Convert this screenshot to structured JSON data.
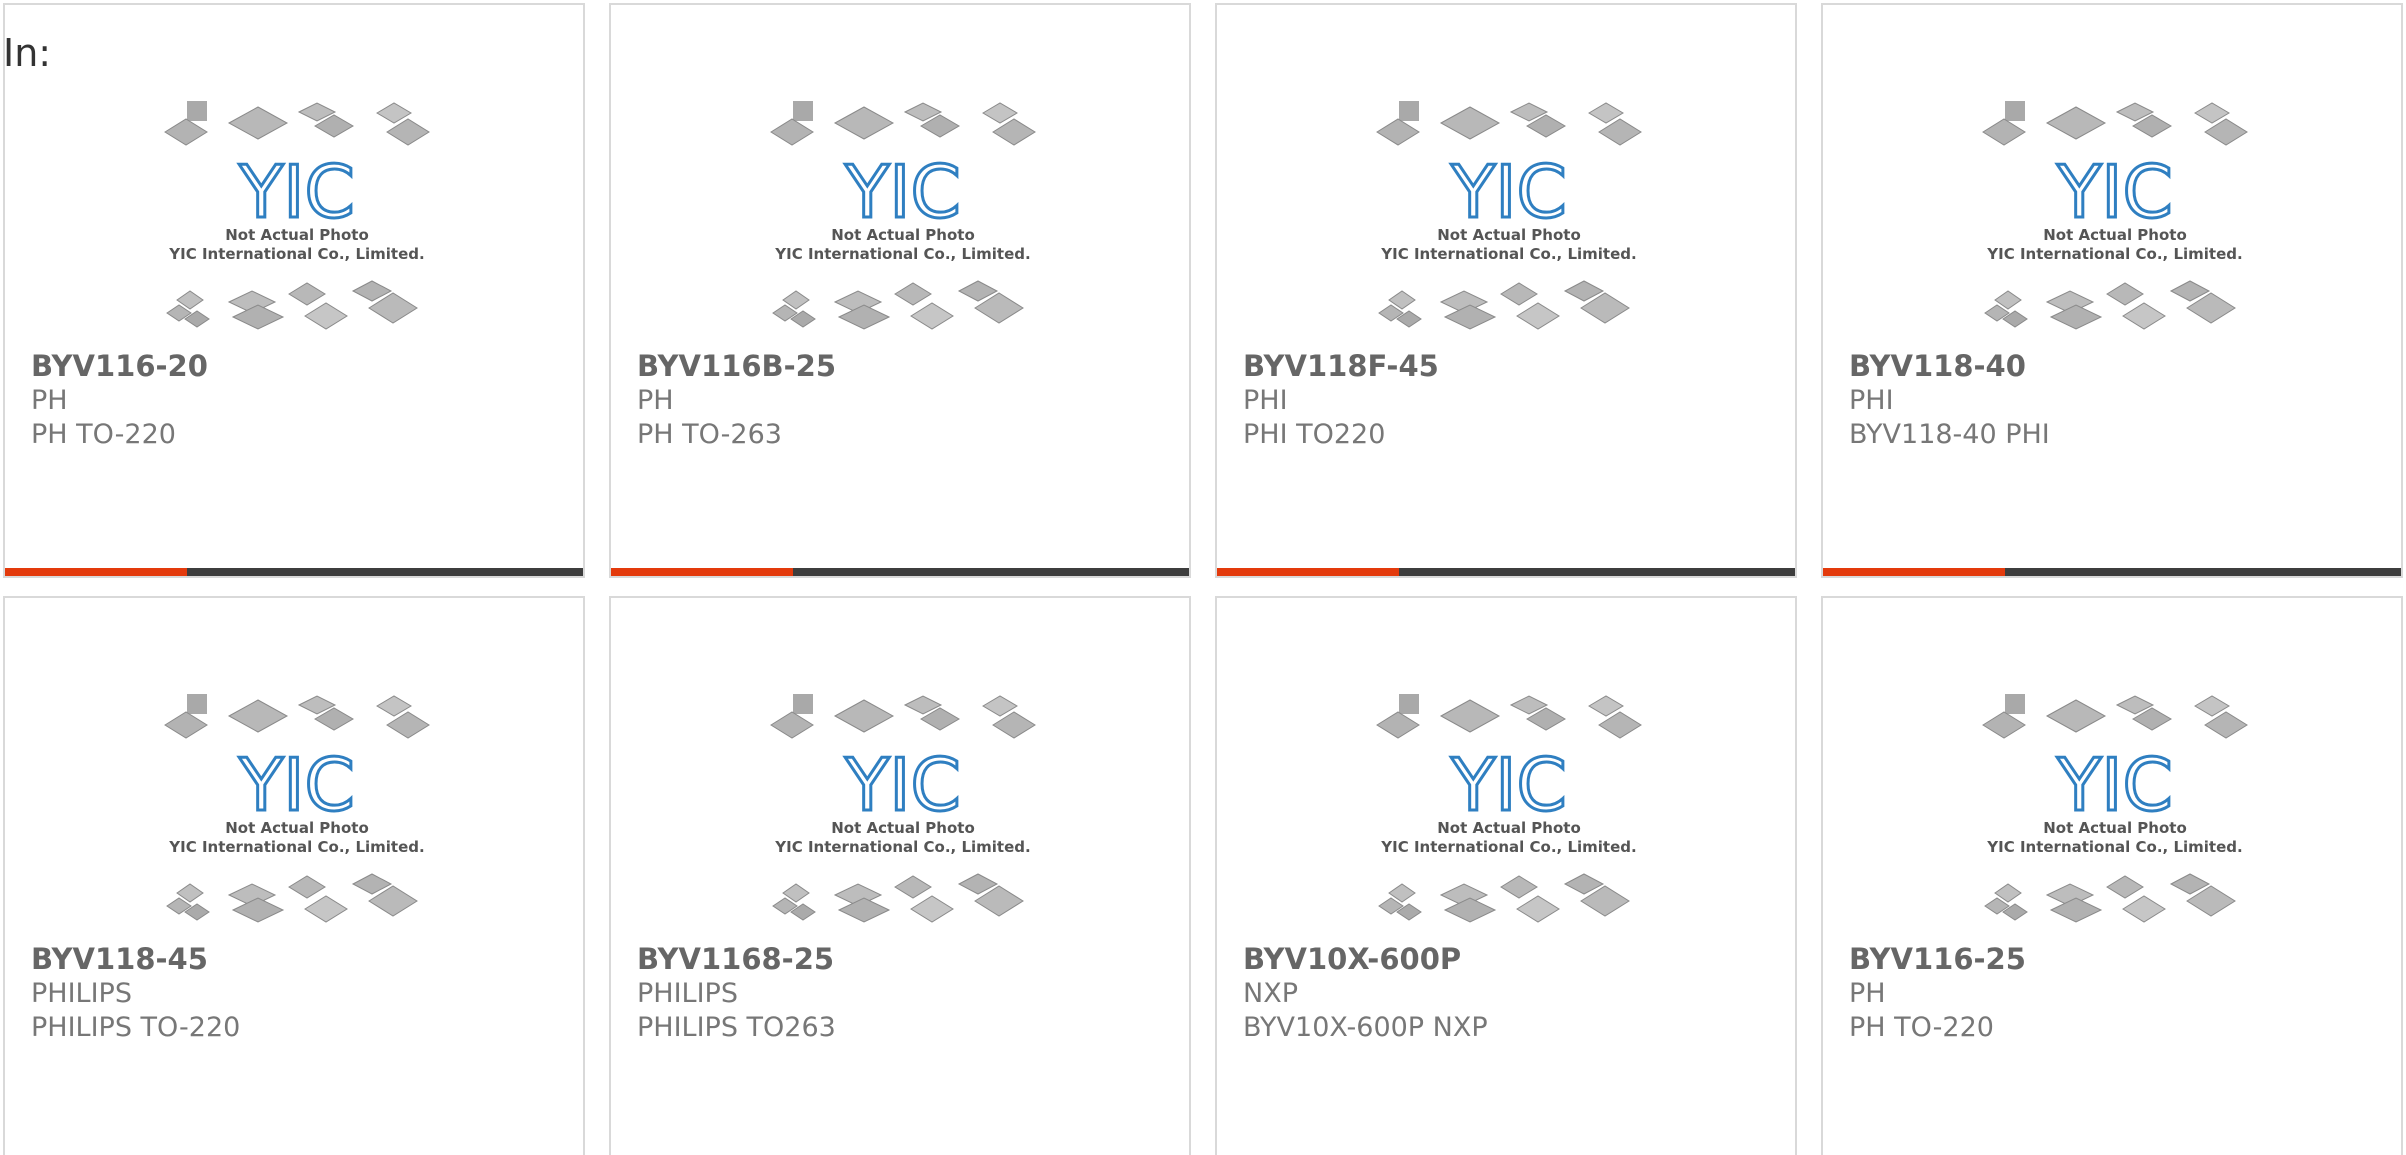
{
  "heading": {
    "prefix": "In:"
  },
  "photo": {
    "line1": "Not Actual Photo",
    "line2": "YIC International Co., Limited.",
    "logo_text": "YIC"
  },
  "colors": {
    "accent": "#e33a0c",
    "bar": "#3d3d3d",
    "logo": "#2f7fc1"
  },
  "products": [
    {
      "part": "BYV116-20",
      "maker": "PH",
      "desc": "PH TO-220"
    },
    {
      "part": "BYV116B-25",
      "maker": "PH",
      "desc": "PH TO-263"
    },
    {
      "part": "BYV118F-45",
      "maker": "PHI",
      "desc": "PHI TO220"
    },
    {
      "part": "BYV118-40",
      "maker": "PHI",
      "desc": "BYV118-40 PHI"
    },
    {
      "part": "BYV118-45",
      "maker": "PHILIPS",
      "desc": "PHILIPS TO-220"
    },
    {
      "part": "BYV1168-25",
      "maker": "PHILIPS",
      "desc": "PHILIPS TO263"
    },
    {
      "part": "BYV10X-600P",
      "maker": "NXP",
      "desc": "BYV10X-600P NXP"
    },
    {
      "part": "BYV116-25",
      "maker": "PH",
      "desc": "PH TO-220"
    }
  ]
}
